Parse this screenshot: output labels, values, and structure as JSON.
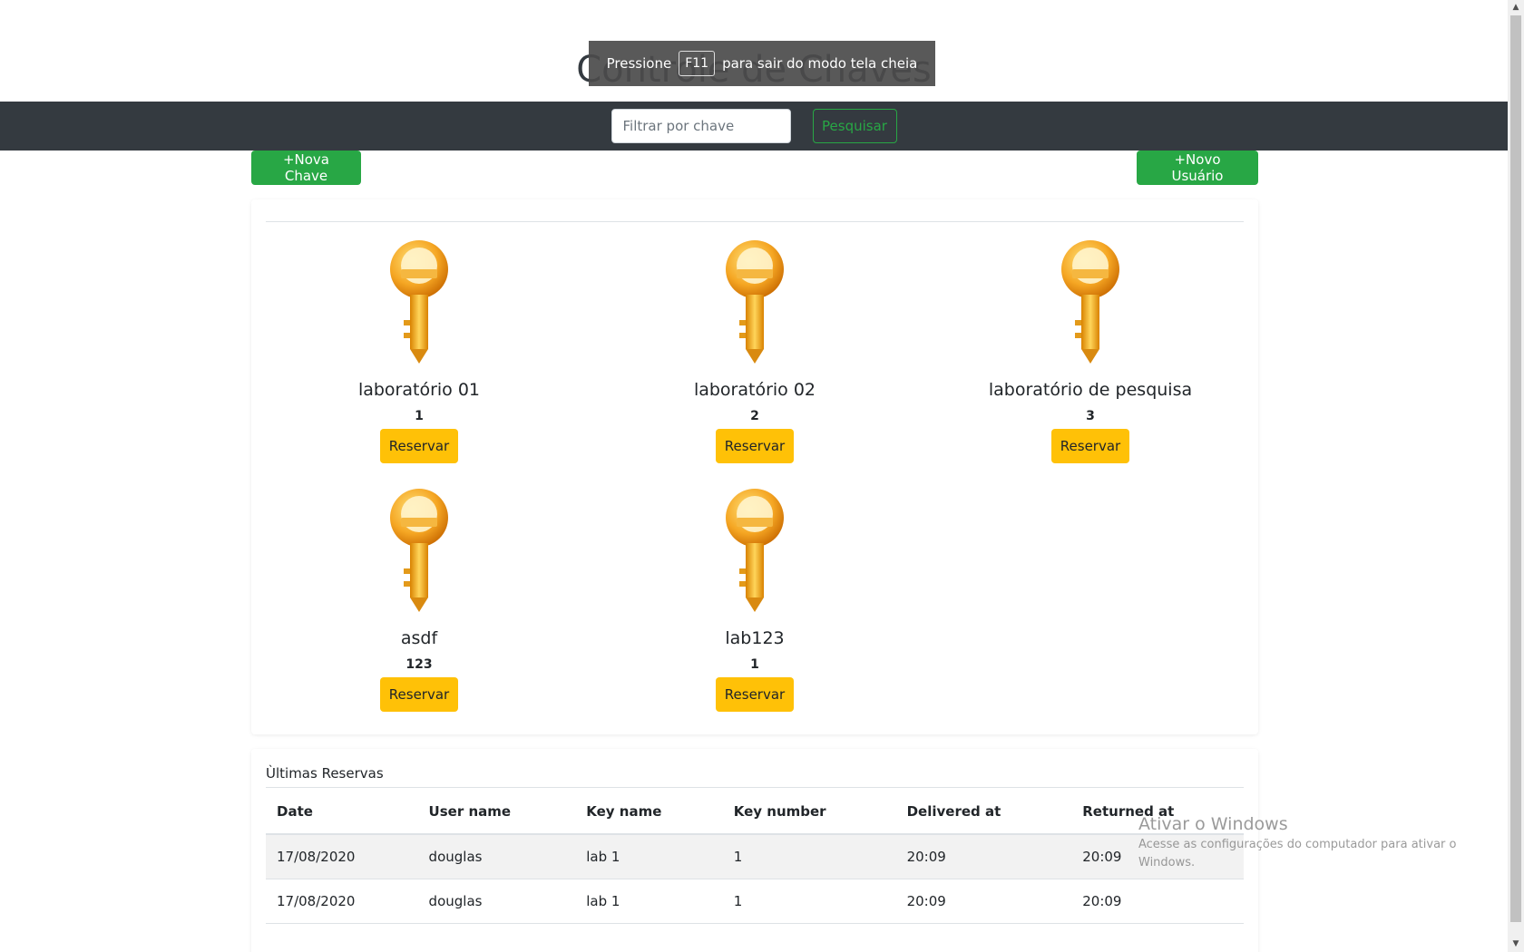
{
  "header": {
    "title": "Controle de Chaves"
  },
  "fullscreen_notice": {
    "prefix": "Pressione",
    "key": "F11",
    "suffix": "para sair do modo tela cheia"
  },
  "search": {
    "placeholder": "Filtrar por chave",
    "button_label": "Pesquisar"
  },
  "actions": {
    "new_key_label": "+Nova Chave",
    "new_user_label": "+Novo Usuário"
  },
  "keys": [
    {
      "name": "laboratório 01",
      "number": "1",
      "button_label": "Reservar",
      "icon": "key-icon"
    },
    {
      "name": "laboratório 02",
      "number": "2",
      "button_label": "Reservar",
      "icon": "key-icon"
    },
    {
      "name": "laboratório de pesquisa",
      "number": "3",
      "button_label": "Reservar",
      "icon": "key-icon"
    },
    {
      "name": "asdf",
      "number": "123",
      "button_label": "Reservar",
      "icon": "key-icon"
    },
    {
      "name": "lab123",
      "number": "1",
      "button_label": "Reservar",
      "icon": "key-icon"
    }
  ],
  "reservations": {
    "title": "Ùltimas Reservas",
    "columns": [
      "Date",
      "User name",
      "Key name",
      "Key number",
      "Delivered at",
      "Returned at"
    ],
    "rows": [
      [
        "17/08/2020",
        "douglas",
        "lab 1",
        "1",
        "20:09",
        "20:09"
      ],
      [
        "17/08/2020",
        "douglas",
        "lab 1",
        "1",
        "20:09",
        "20:09"
      ]
    ]
  },
  "windows_activation": {
    "title": "Ativar o Windows",
    "subtitle": "Acesse as configurações do computador para ativar o Windows."
  },
  "colors": {
    "navbar": "#343a40",
    "success": "#28a745",
    "warning": "#ffc107",
    "key_gold": "#f0a020"
  }
}
